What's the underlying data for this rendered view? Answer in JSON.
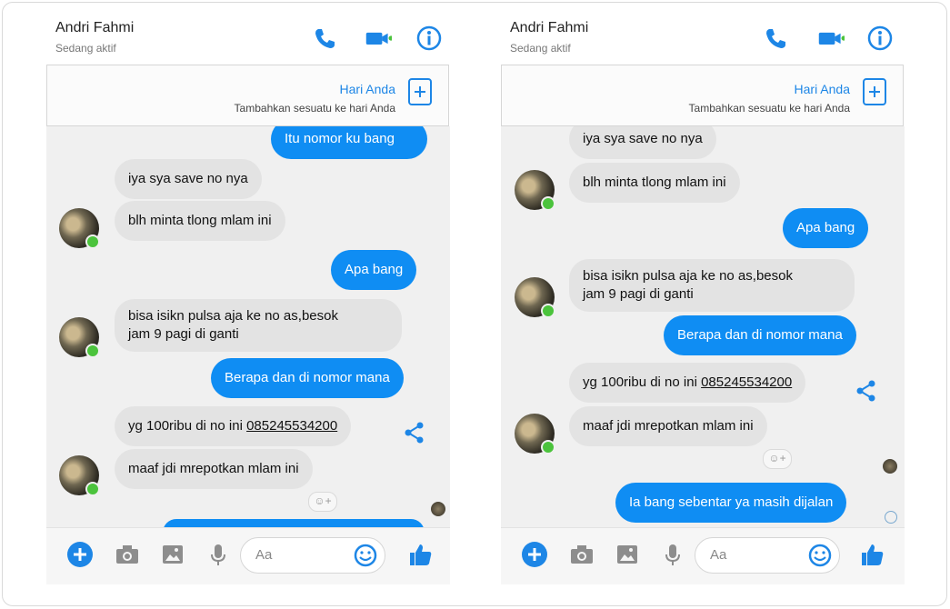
{
  "left": {
    "header": {
      "name": "Andri Fahmi",
      "status": "Sedang aktif"
    },
    "story": {
      "title": "Hari Anda",
      "subtitle": "Tambahkan sesuatu ke hari Anda"
    },
    "messages": {
      "m1": "Itu nomor ku bang",
      "m2": "iya sya save no nya",
      "m3": "blh minta tlong mlam ini",
      "m4": "Apa bang",
      "m5_l1": "bisa isikn pulsa aja ke no as,besok",
      "m5_l2": "jam 9 pagi di ganti",
      "m6": "Berapa dan di nomor mana",
      "m7_prefix": "yg 100ribu di no ini ",
      "m7_number": "085245534200",
      "m8": "maaf jdi mrepotkan mlam ini"
    },
    "composer": {
      "placeholder": "Aa"
    }
  },
  "right": {
    "header": {
      "name": "Andri Fahmi",
      "status": "Sedang aktif"
    },
    "story": {
      "title": "Hari Anda",
      "subtitle": "Tambahkan sesuatu ke hari Anda"
    },
    "messages": {
      "m1": "iya sya save no nya",
      "m2": "blh minta tlong mlam ini",
      "m3": "Apa bang",
      "m4_l1": "bisa isikn pulsa aja ke no as,besok",
      "m4_l2": "jam 9 pagi di ganti",
      "m5": "Berapa dan di nomor mana",
      "m6_prefix": "yg 100ribu di no ini ",
      "m6_number": "085245534200",
      "m7": "maaf jdi mrepotkan mlam ini",
      "m8": "Ia bang sebentar ya masih dijalan"
    },
    "composer": {
      "placeholder": "Aa"
    }
  },
  "colors": {
    "accent": "#0f8df3",
    "online": "#4bc33c"
  },
  "icons": [
    "phone-icon",
    "video-call-icon",
    "info-icon",
    "add-story-icon",
    "share-icon",
    "add-icon",
    "camera-icon",
    "image-icon",
    "mic-icon",
    "emoji-icon",
    "thumbs-up-icon",
    "react-icon",
    "seen-icon"
  ]
}
